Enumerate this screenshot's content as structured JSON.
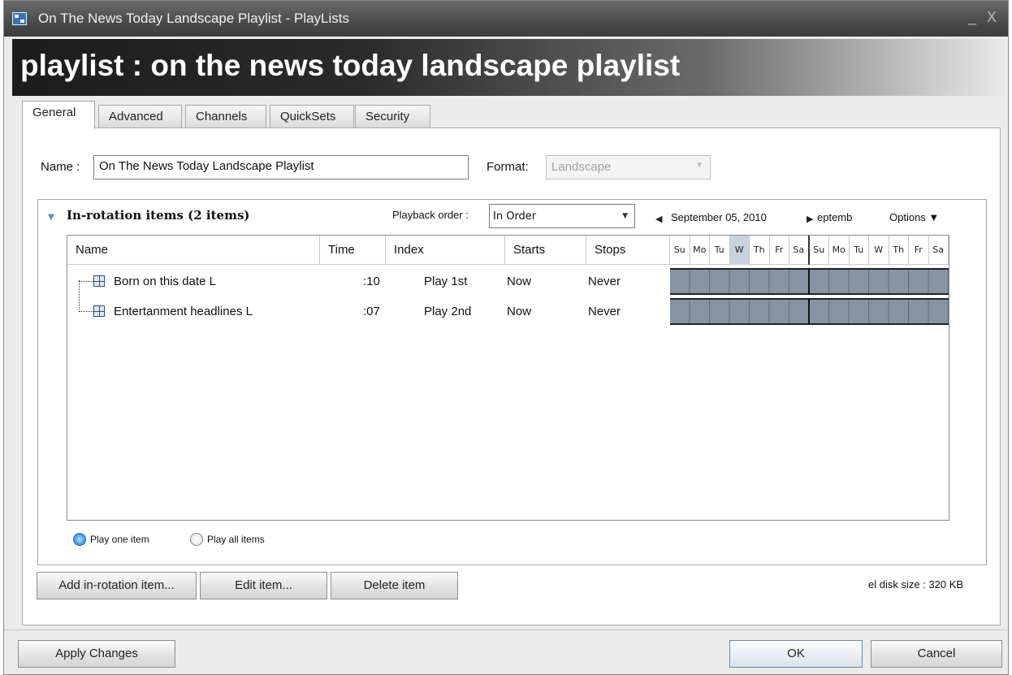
{
  "window": {
    "title": "On The News Today Landscape Playlist  - PlayLists",
    "controls": "_ X",
    "app_icon": "playlist-app-icon"
  },
  "banner": {
    "title": "playlist : on the news today landscape playlist"
  },
  "tabs": [
    {
      "label": "General",
      "active": true
    },
    {
      "label": "Advanced",
      "active": false
    },
    {
      "label": "Channels",
      "active": false
    },
    {
      "label": "QuickSets",
      "active": false
    },
    {
      "label": "Security",
      "active": false
    }
  ],
  "general": {
    "name_label": "Name :",
    "name_value": "On The News Today Landscape Playlist",
    "format_label": "Format:",
    "format_value": "Landscape"
  },
  "rotation": {
    "title": "In-rotation items (2 items)",
    "playback_label": "Playback order :",
    "playback_value": "In Order",
    "date_label": "September 05, 2010",
    "next_date_label": "eptemb",
    "options_label": "Options ▼",
    "columns": [
      "Name",
      "Time",
      "Index",
      "Starts",
      "Stops"
    ],
    "days": [
      "Su",
      "Mo",
      "Tu",
      "W",
      "Th",
      "Fr",
      "Sa",
      "Su",
      "Mo",
      "Tu",
      "W",
      "Th",
      "Fr",
      "Sa"
    ],
    "today_index": 3,
    "rows": [
      {
        "name": "Born on this date L",
        "time": ":10",
        "index": "Play 1st",
        "starts": "Now",
        "stops": "Never"
      },
      {
        "name": "Entertanment headlines L",
        "time": ":07",
        "index": "Play 2nd",
        "starts": "Now",
        "stops": "Never"
      }
    ],
    "radio_one": "Play one item",
    "radio_all": "Play all items",
    "selected_radio": "one"
  },
  "actions": {
    "add": "Add in-rotation item...",
    "edit": "Edit item...",
    "delete": "Delete item",
    "disk_size": "el disk size : 320 KB"
  },
  "footer": {
    "apply": "Apply Changes",
    "ok": "OK",
    "cancel": "Cancel"
  },
  "colors": {
    "schedule_fill": "#8593a3",
    "today_highlight": "#c8d3e0",
    "selected_radio": "#2f78c4"
  }
}
